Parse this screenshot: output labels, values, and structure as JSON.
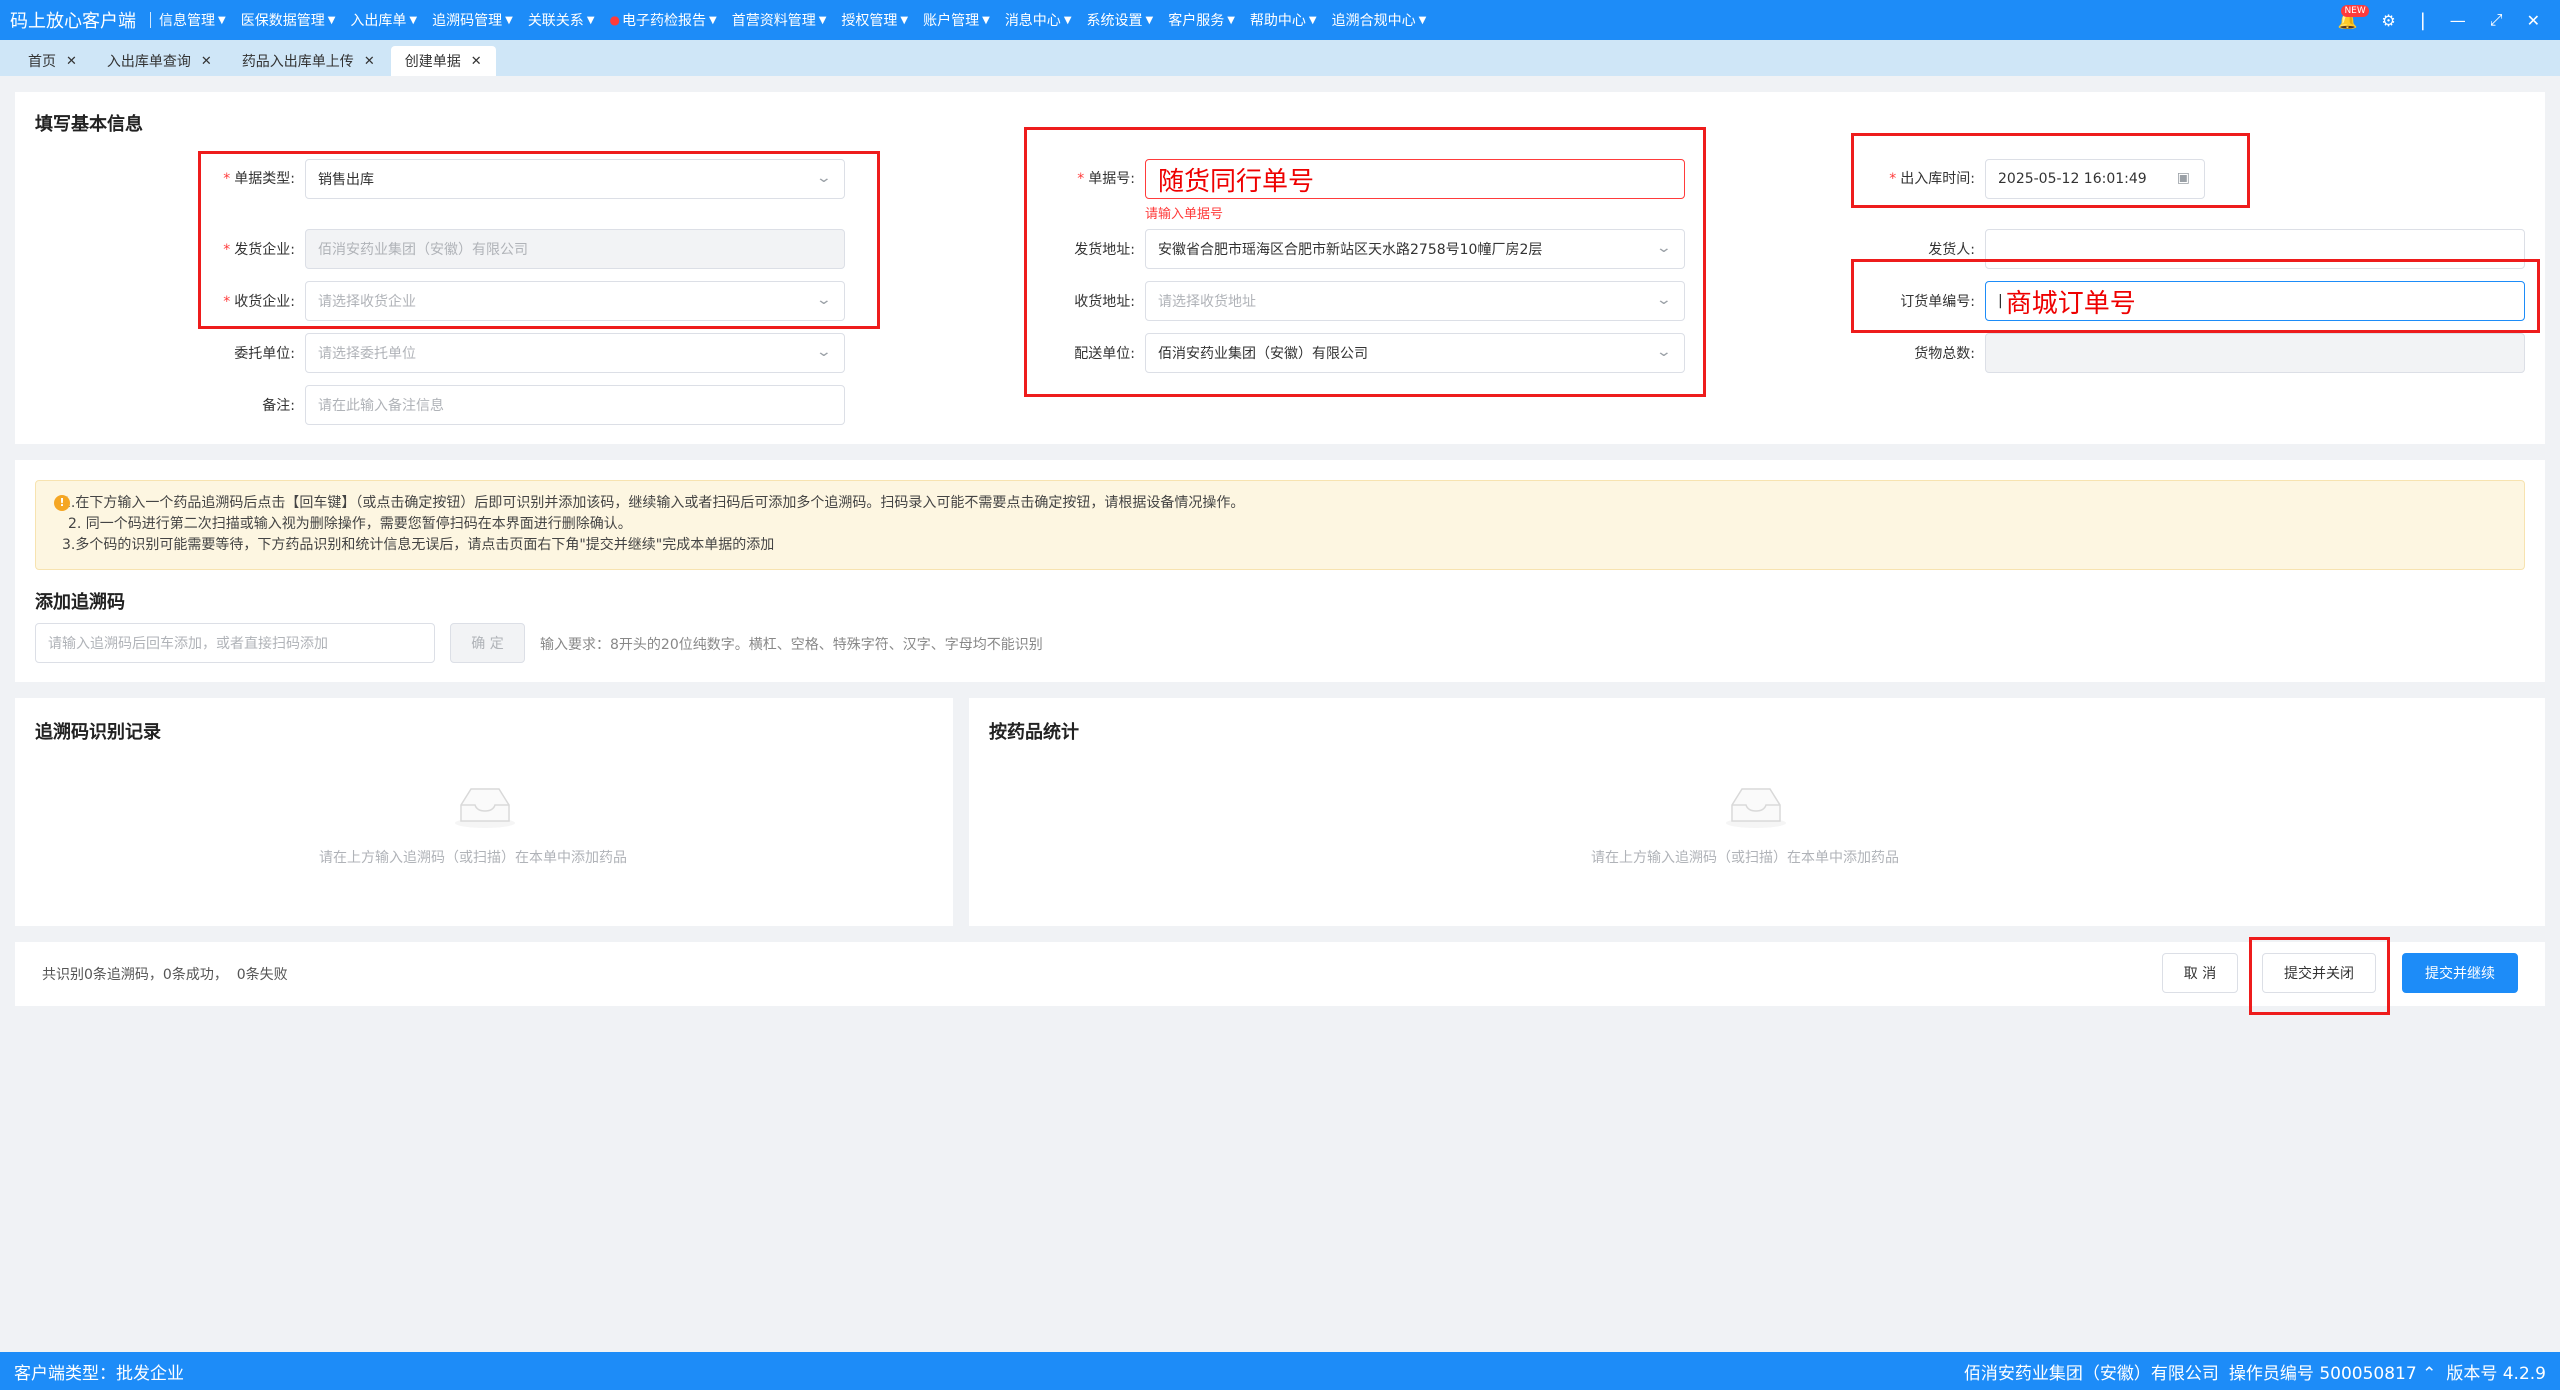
{
  "app": {
    "title": "码上放心客户端",
    "menu": [
      {
        "label": "信息管理",
        "dot": false
      },
      {
        "label": "医保数据管理",
        "dot": false
      },
      {
        "label": "入出库单",
        "dot": false
      },
      {
        "label": "追溯码管理",
        "dot": false
      },
      {
        "label": "关联关系",
        "dot": false
      },
      {
        "label": "电子药检报告",
        "dot": true
      },
      {
        "label": "首营资料管理",
        "dot": false
      },
      {
        "label": "授权管理",
        "dot": false
      },
      {
        "label": "账户管理",
        "dot": false
      },
      {
        "label": "消息中心",
        "dot": false
      },
      {
        "label": "系统设置",
        "dot": false
      },
      {
        "label": "客户服务",
        "dot": false
      },
      {
        "label": "帮助中心",
        "dot": false
      },
      {
        "label": "追溯合规中心",
        "dot": false
      }
    ],
    "new_badge": "NEW",
    "icons": {
      "bell": "bell-icon",
      "settings": "gear-icon",
      "minimize": "minimize-icon",
      "maximize": "maximize-icon",
      "close": "close-icon"
    }
  },
  "tabs": [
    {
      "label": "首页",
      "closable": true,
      "active": false
    },
    {
      "label": "入出库单查询",
      "closable": true,
      "active": false
    },
    {
      "label": "药品入出库单上传",
      "closable": true,
      "active": false
    },
    {
      "label": "创建单据",
      "closable": true,
      "active": true
    }
  ],
  "basic_info": {
    "title": "填写基本信息",
    "doc_type": {
      "label": "单据类型:",
      "value": "销售出库"
    },
    "sender_company": {
      "label": "发货企业:",
      "value": "佰消安药业集团（安徽）有限公司"
    },
    "receiver_company": {
      "label": "收货企业:",
      "placeholder": "请选择收货企业"
    },
    "entrusted": {
      "label": "委托单位:",
      "placeholder": "请选择委托单位"
    },
    "remark": {
      "label": "备注:",
      "placeholder": "请在此输入备注信息"
    },
    "doc_no": {
      "label": "单据号:",
      "value": "随货同行单号",
      "error": "请输入单据号"
    },
    "ship_address": {
      "label": "发货地址:",
      "value": "安徽省合肥市瑶海区合肥市新站区天水路2758号10幢厂房2层"
    },
    "receive_address": {
      "label": "收货地址:",
      "placeholder": "请选择收货地址"
    },
    "delivery_unit": {
      "label": "配送单位:",
      "value": "佰消安药业集团（安徽）有限公司"
    },
    "io_time": {
      "label": "出入库时间:",
      "value": "2025-05-12 16:01:49"
    },
    "shipper": {
      "label": "发货人:",
      "value": ""
    },
    "order_no": {
      "label": "订货单编号:",
      "value": "商城订单号"
    },
    "total_goods": {
      "label": "货物总数:",
      "value": ""
    }
  },
  "notice": {
    "lines": [
      "1.在下方输入一个药品追溯码后点击【回车键】（或点击确定按钮）后即可识别并添加该码，继续输入或者扫码后可添加多个追溯码。扫码录入可能不需要点击确定按钮，请根据设备情况操作。",
      "2. 同一个码进行第二次扫描或输入视为删除操作，需要您暂停扫码在本界面进行删除确认。",
      "3.多个码的识别可能需要等待，下方药品识别和统计信息无误后，请点击页面右下角\"提交并继续\"完成本单据的添加"
    ]
  },
  "trace": {
    "title": "添加追溯码",
    "placeholder": "请输入追溯码后回车添加，或者直接扫码添加",
    "confirm_label": "确 定",
    "hint": "输入要求：8开头的20位纯数字。横杠、空格、特殊字符、汉字、字母均不能识别"
  },
  "records": {
    "title": "追溯码识别记录",
    "empty": "请在上方输入追溯码（或扫描）在本单中添加药品"
  },
  "stats": {
    "title": "按药品统计",
    "empty": "请在上方输入追溯码（或扫描）在本单中添加药品"
  },
  "action_bar": {
    "summary": "共识别0条追溯码，0条成功，  0条失败",
    "cancel": "取 消",
    "submit_close": "提交并关闭",
    "submit_continue": "提交并继续"
  },
  "footer": {
    "client_type": "客户端类型：批发企业",
    "company": "佰消安药业集团（安徽）有限公司",
    "operator": "操作员编号 500050817",
    "version": "版本号 4.2.9"
  },
  "colors": {
    "primary": "#1d8cf8",
    "annotation": "#ee1c1c",
    "error": "#ff3b3b"
  }
}
